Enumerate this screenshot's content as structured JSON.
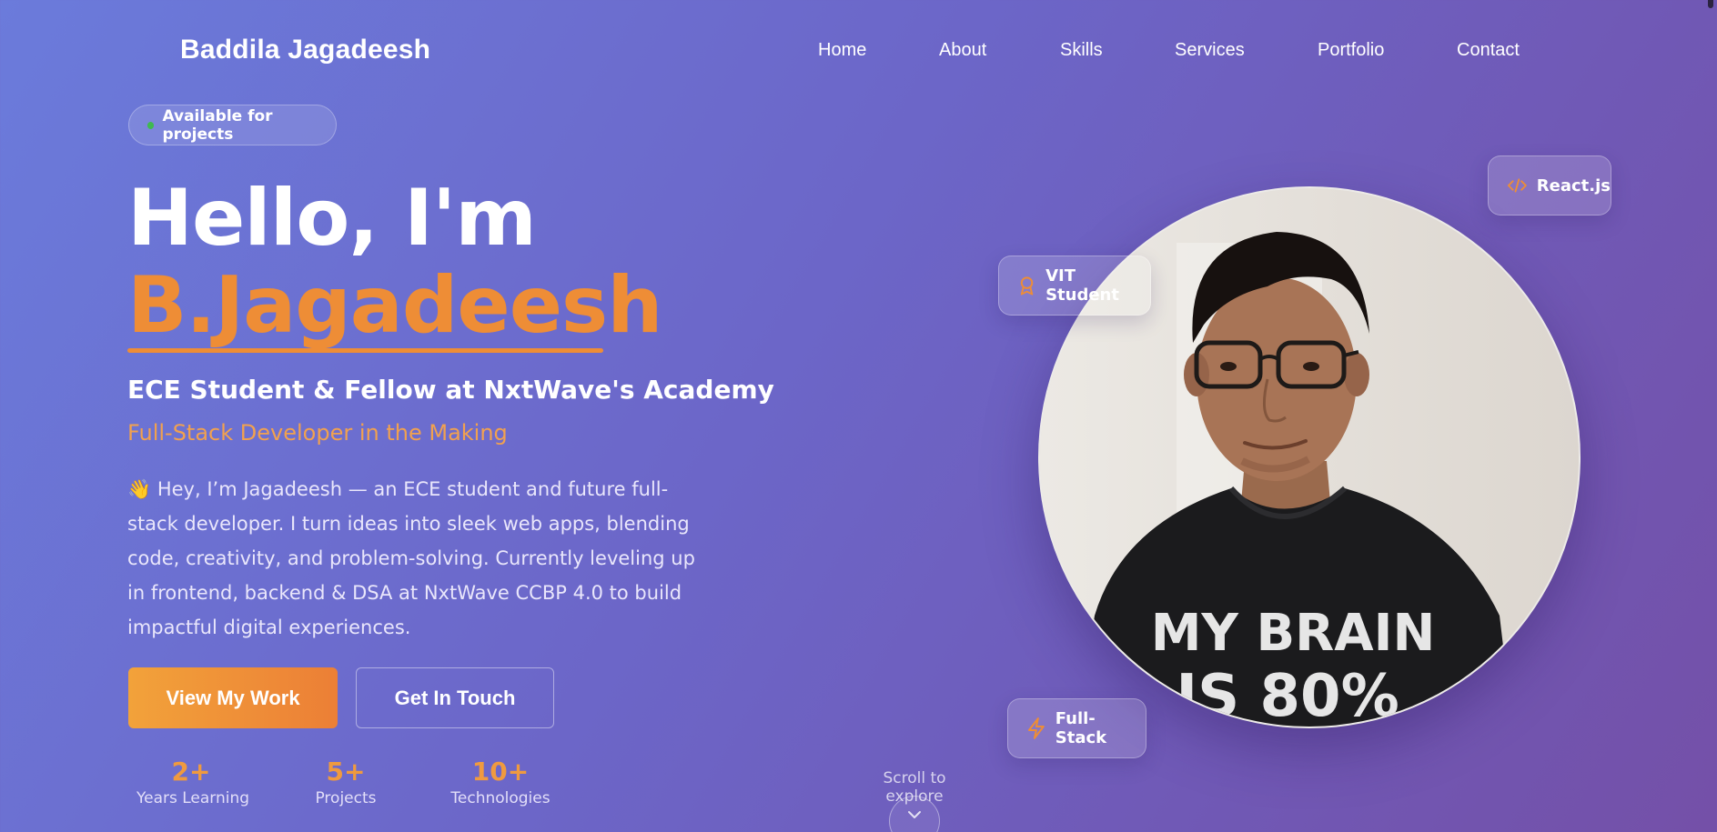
{
  "brand": "Baddila Jagadeesh",
  "nav": [
    {
      "label": "Home"
    },
    {
      "label": "About"
    },
    {
      "label": "Skills"
    },
    {
      "label": "Services"
    },
    {
      "label": "Portfolio"
    },
    {
      "label": "Contact"
    }
  ],
  "hero": {
    "availability": "Available for projects",
    "greeting": "Hello, I'm",
    "name": "B.Jagadeesh",
    "role": "ECE Student & Fellow at NxtWave's Academy",
    "tagline": "Full-Stack Developer in the Making",
    "bio_emoji": "👋",
    "bio": "Hey, I’m Jagadeesh — an ECE student and future full-stack developer. I turn ideas into sleek web apps, blending code, creativity, and problem-solving. Currently leveling up in frontend, backend & DSA at NxtWave CCBP 4.0 to build impactful digital experiences.",
    "primary_button": "View My Work",
    "secondary_button": "Get In Touch"
  },
  "stats": [
    {
      "value": "2+",
      "label": "Years Learning"
    },
    {
      "value": "5+",
      "label": "Projects"
    },
    {
      "value": "10+",
      "label": "Technologies"
    }
  ],
  "scroll_hint": "Scroll to explore",
  "badges": {
    "vit": {
      "label": "VIT Student",
      "icon": "award-icon"
    },
    "react": {
      "label": "React.js",
      "icon": "code-icon"
    },
    "fullstack": {
      "label": "Full-Stack",
      "icon": "lightning-icon"
    }
  },
  "photo": {
    "shirt_text_line1": "MY BRAIN",
    "shirt_text_line2": "IS 80%"
  },
  "colors": {
    "accent": "#ee8d36",
    "status_dot": "#3fb950",
    "background_start": "#6b7bdb",
    "background_end": "#7450a8"
  }
}
